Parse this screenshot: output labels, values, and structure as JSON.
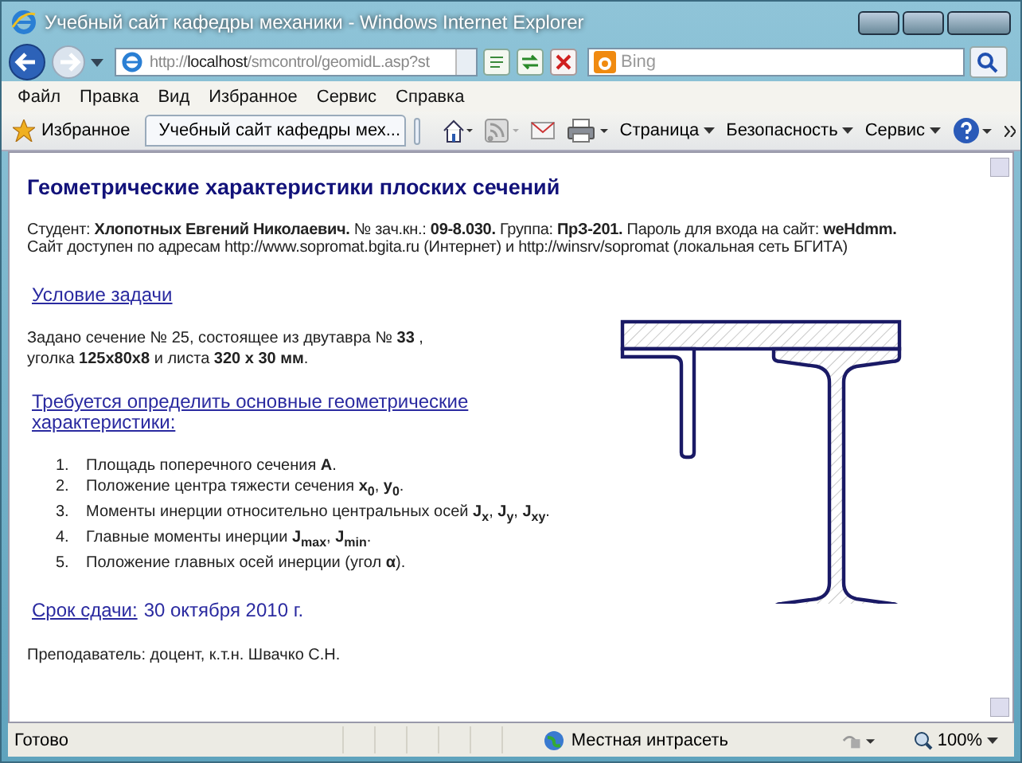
{
  "window": {
    "title": "Учебный сайт кафедры механики - Windows Internet Explorer"
  },
  "address_bar": {
    "prefix": "http://",
    "host": "localhost",
    "path": "/smcontrol/geomidL.asp?st"
  },
  "search": {
    "placeholder": "Bing"
  },
  "menu": [
    "Файл",
    "Правка",
    "Вид",
    "Избранное",
    "Сервис",
    "Справка"
  ],
  "favorites_button": "Избранное",
  "tab": {
    "title": "Учебный сайт кафедры мех..."
  },
  "commands": [
    "Страница",
    "Безопасность",
    "Сервис"
  ],
  "page": {
    "heading": "Геометрические характеристики плоских сечений",
    "student_line": "Студент: **Хлопотных Евгений Николаевич.**  № зач.кн.: **09-8.030.**  Группа: **ПрЗ-201.**  Пароль для входа на сайт: **weHdmm.**",
    "site_line": "Сайт доступен по адресам http://www.sopromat.bgita.ru (Интернет) и http://winsrv/sopromat (локальная сеть БГИТА)",
    "condition_link": "Условие задачи",
    "task_text": "Задано сечение № 25, состоящее из двутавра № **33** , уголка **125x80x8** и листа **320 x 30 мм**.",
    "requirement_link": "Требуется определить основные геометрические характеристики:",
    "items": [
      {
        "number": "1.",
        "text": "Площадь поперечного сечения **A**."
      },
      {
        "number": "2.",
        "text": "Положение центра тяжести сечения **x**$_{0}$, **y**$_{0}$."
      },
      {
        "number": "3.",
        "text": "Моменты инерции относительно центральных осей **J**$_{x}$, **J**$_{y}$, **J**$_{xy}$."
      },
      {
        "number": "4.",
        "text": "Главные моменты инерции **J**$_{max}$, **J**$_{min}$."
      },
      {
        "number": "5.",
        "text": "Положение главных осей инерции (угол **α**)."
      }
    ],
    "deadline_link": "Срок сдачи:",
    "deadline_date": "30 октября 2010 г.",
    "teacher": "Преподаватель: доцент, к.т.н. Швачко С.Н."
  },
  "status_bar": {
    "text": "Готово",
    "zone": "Местная интрасеть",
    "zoom": "100%"
  }
}
